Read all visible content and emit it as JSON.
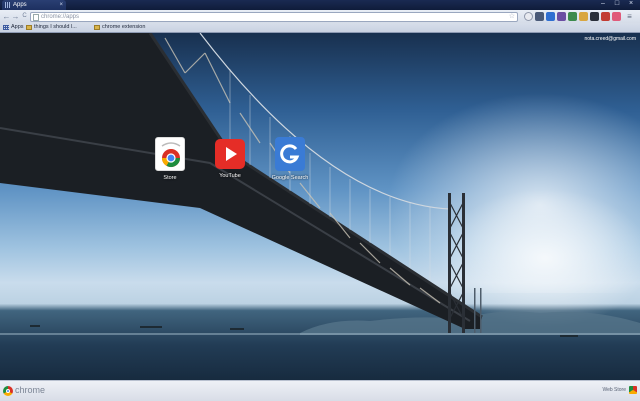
{
  "tab": {
    "title": "Apps",
    "close": "×"
  },
  "window_controls": {
    "minimize": "–",
    "maximize": "□",
    "close": "×"
  },
  "toolbar": {
    "back": "←",
    "forward": "→",
    "reload": "C",
    "url": "chrome://apps",
    "star": "☆"
  },
  "bookmarks": {
    "items": [
      {
        "label": "Apps"
      },
      {
        "label": "things I should l..."
      },
      {
        "label": "chrome extension"
      }
    ]
  },
  "account": {
    "email": "nota.creed@gmail.com"
  },
  "apps": [
    {
      "label": "Store"
    },
    {
      "label": "YouTube"
    },
    {
      "label": "Google Search"
    }
  ],
  "bottom": {
    "brand": "chrome",
    "webstore": "Web Store"
  },
  "colors": {
    "tabstrip": "#1a2a52",
    "youtube": "#e52d27",
    "google_search": "#3a7bd5"
  }
}
